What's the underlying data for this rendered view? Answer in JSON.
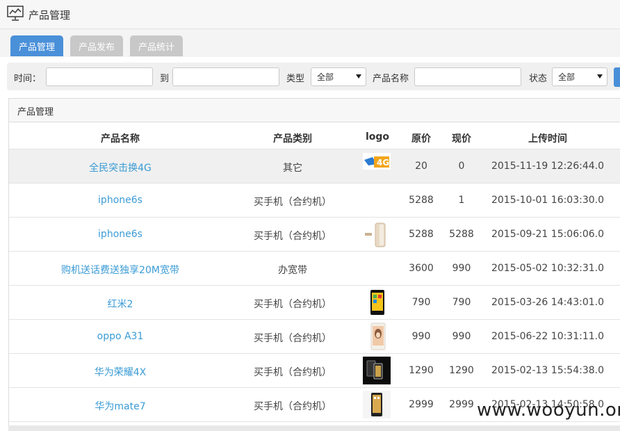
{
  "header": {
    "title": "产品管理",
    "icon": "chart-monitor-icon"
  },
  "tabs": [
    {
      "label": "产品管理",
      "active": true
    },
    {
      "label": "产品发布",
      "active": false
    },
    {
      "label": "产品统计",
      "active": false
    }
  ],
  "filters": {
    "time_label": "时间：",
    "to_label": "到",
    "type_label": "类型",
    "type_value": "全部",
    "name_label": "产品名称",
    "status_label": "状态",
    "status_value": "全部"
  },
  "panel": {
    "title": "产品管理"
  },
  "table": {
    "columns": [
      "产品名称",
      "产品类别",
      "logo",
      "原价",
      "现价",
      "上传时间"
    ],
    "rows": [
      {
        "name": "全民突击换4G",
        "category": "其它",
        "logo": "4g-banner",
        "original_price": "20",
        "current_price": "0",
        "uploaded": "2015-11-19 12:26:44.0"
      },
      {
        "name": "iphone6s",
        "category": "买手机（合约机）",
        "logo": "",
        "original_price": "5288",
        "current_price": "1",
        "uploaded": "2015-10-01 16:03:30.0"
      },
      {
        "name": "iphone6s",
        "category": "买手机（合约机）",
        "logo": "iphone-image",
        "original_price": "5288",
        "current_price": "5288",
        "uploaded": "2015-09-21 15:06:06.0"
      },
      {
        "name": "购机送话费送独享20M宽带",
        "category": "办宽带",
        "logo": "",
        "original_price": "3600",
        "current_price": "990",
        "uploaded": "2015-05-02 10:32:31.0"
      },
      {
        "name": "红米2",
        "category": "买手机（合约机）",
        "logo": "redmi-phone-image",
        "original_price": "790",
        "current_price": "790",
        "uploaded": "2015-03-26 14:43:01.0"
      },
      {
        "name": "oppo A31",
        "category": "买手机（合约机）",
        "logo": "oppo-phone-image",
        "original_price": "990",
        "current_price": "990",
        "uploaded": "2015-06-22 10:31:11.0"
      },
      {
        "name": "华为荣耀4X",
        "category": "买手机（合约机）",
        "logo": "honor-phone-image",
        "original_price": "1290",
        "current_price": "1290",
        "uploaded": "2015-02-13 15:54:38.0"
      },
      {
        "name": "华为mate7",
        "category": "买手机（合约机）",
        "logo": "mate7-phone-image",
        "original_price": "2999",
        "current_price": "2999",
        "uploaded": "2015-02-13 14:50:58.0"
      }
    ]
  },
  "watermark": "www.wooyun.org",
  "colors": {
    "accent": "#4a90d9",
    "link": "#3a9bd5",
    "tab_inactive": "#c8c8c8"
  }
}
